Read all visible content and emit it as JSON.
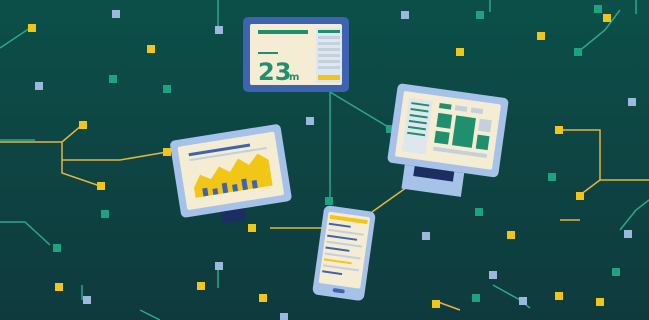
{
  "illustration": {
    "big_number": "23",
    "unit": "m"
  },
  "colors": {
    "background_top": "#0c4d48",
    "background_bottom": "#0f3b3d",
    "circuit_line_yellow": "#e3b63a",
    "circuit_line_teal": "#25a88c",
    "node_yellow": "#f2c617",
    "node_green": "#1fa27f",
    "node_blue": "#9cb8dc",
    "device_frame": "#3e64b1",
    "device_frame_light": "#a7c2e8",
    "screen_bg": "#f5ecd4",
    "accent_green": "#1f8f6d",
    "accent_yellow": "#f2c617",
    "stand_dark": "#1c2e61"
  }
}
